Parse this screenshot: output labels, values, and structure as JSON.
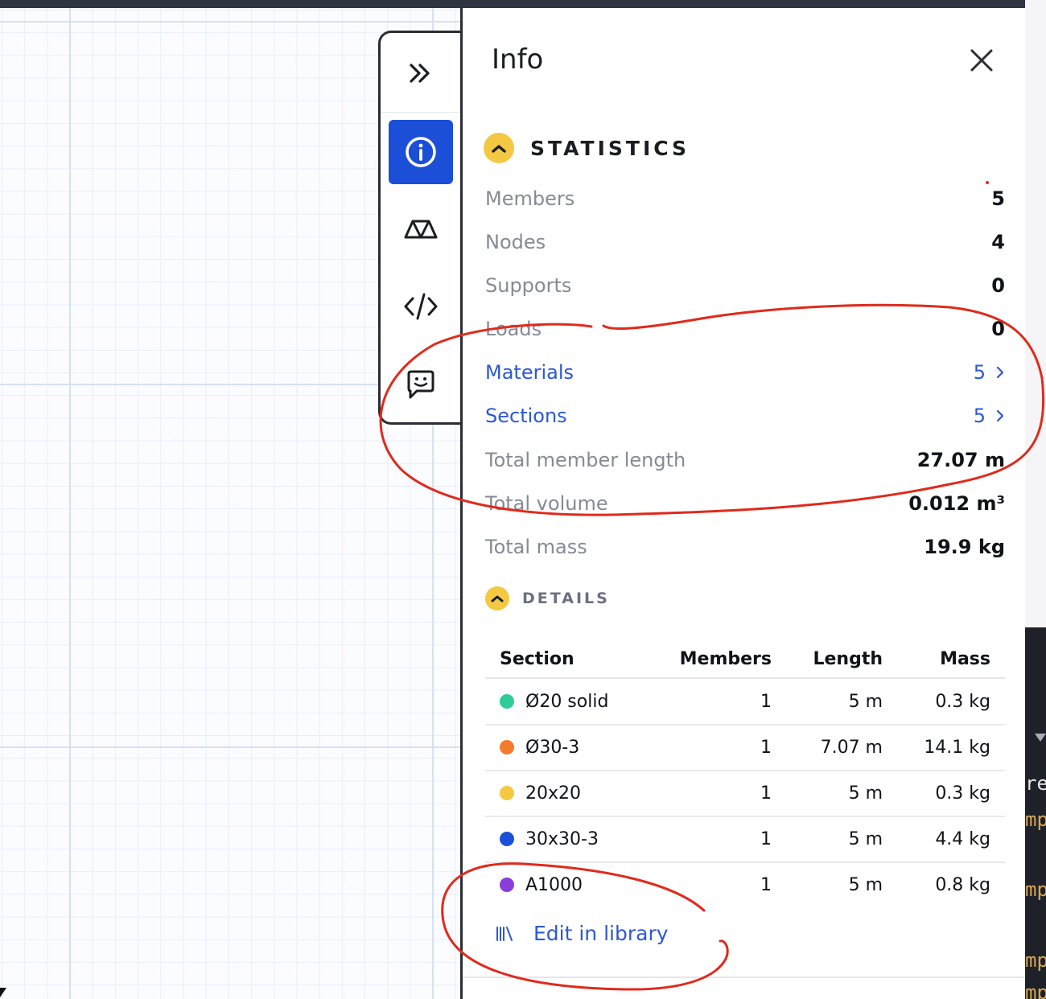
{
  "panel": {
    "title": "Info",
    "close_label": "close"
  },
  "toolbar": {
    "items": [
      {
        "name": "collapse",
        "icon": "double-chevron-right-icon"
      },
      {
        "name": "info",
        "icon": "info-circle-icon",
        "active": true
      },
      {
        "name": "structure",
        "icon": "truss-icon"
      },
      {
        "name": "code",
        "icon": "code-icon"
      },
      {
        "name": "feedback",
        "icon": "chat-smile-icon"
      }
    ],
    "accent": "#1c4fd8"
  },
  "statistics": {
    "title": "STATISTICS",
    "rows": [
      {
        "label": "Members",
        "value": "5"
      },
      {
        "label": "Nodes",
        "value": "4"
      },
      {
        "label": "Supports",
        "value": "0"
      },
      {
        "label": "Loads",
        "value": "0"
      },
      {
        "label": "Materials",
        "value": "5"
      },
      {
        "label": "Sections",
        "value": "5"
      },
      {
        "label": "Total member length",
        "value": "27.07 m"
      },
      {
        "label": "Total volume",
        "value": "0.012 m³"
      },
      {
        "label": "Total mass",
        "value": "19.9 kg"
      }
    ]
  },
  "details": {
    "title": "DETAILS",
    "columns": [
      "Section",
      "Members",
      "Length",
      "Mass"
    ],
    "rows": [
      {
        "section": "Ø20 solid",
        "members": "1",
        "length": "5 m",
        "mass": "0.3 kg",
        "color": "#2ecc9a"
      },
      {
        "section": "Ø30-3",
        "members": "1",
        "length": "7.07 m",
        "mass": "14.1 kg",
        "color": "#f47a2c"
      },
      {
        "section": "20x20",
        "members": "1",
        "length": "5 m",
        "mass": "0.3 kg",
        "color": "#f4c842"
      },
      {
        "section": "30x30-3",
        "members": "1",
        "length": "5 m",
        "mass": "4.4 kg",
        "color": "#1c4fd8"
      },
      {
        "section": "A1000",
        "members": "1",
        "length": "5 m",
        "mass": "0.8 kg",
        "color": "#8a3ddb"
      }
    ],
    "edit_link": "Edit in library"
  },
  "background_editor": {
    "lines": [
      "re",
      "mp",
      "mp",
      "mp",
      "mp"
    ]
  },
  "colors": {
    "link": "#2d57d8",
    "badge": "#f4c842",
    "annotation": "#e02a1c"
  }
}
